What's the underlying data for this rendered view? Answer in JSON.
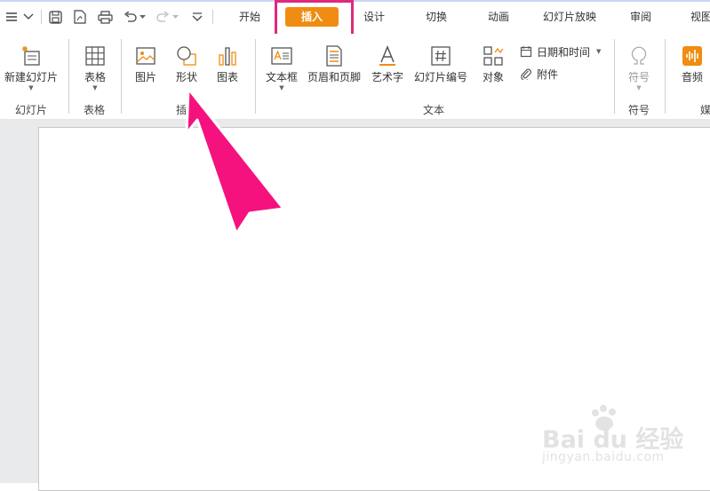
{
  "tabs": [
    {
      "label": "开始"
    },
    {
      "label": "插入"
    },
    {
      "label": "设计"
    },
    {
      "label": "切换"
    },
    {
      "label": "动画"
    },
    {
      "label": "幻灯片放映"
    },
    {
      "label": "审阅"
    },
    {
      "label": "视图"
    }
  ],
  "ribbon": {
    "new_slide": "新建幻灯片",
    "table": "表格",
    "picture": "图片",
    "shape": "形状",
    "chart": "图表",
    "textbox": "文本框",
    "header_footer": "页眉和页脚",
    "wordart": "艺术字",
    "slide_number": "幻灯片编号",
    "object": "对象",
    "date_time": "日期和时间",
    "attachment": "附件",
    "symbol": "符号",
    "audio": "音频"
  },
  "groups": {
    "slides": "幻灯片",
    "table": "表格",
    "insert": "插入",
    "text": "文本",
    "symbol": "符号",
    "media": "媒"
  },
  "watermark": {
    "brand": "Bai du 经验",
    "url": "jingyan.baidu.com"
  },
  "colors": {
    "active_tab": "#f08c12",
    "highlight_box": "#e0297c",
    "arrow": "#f5127e"
  }
}
